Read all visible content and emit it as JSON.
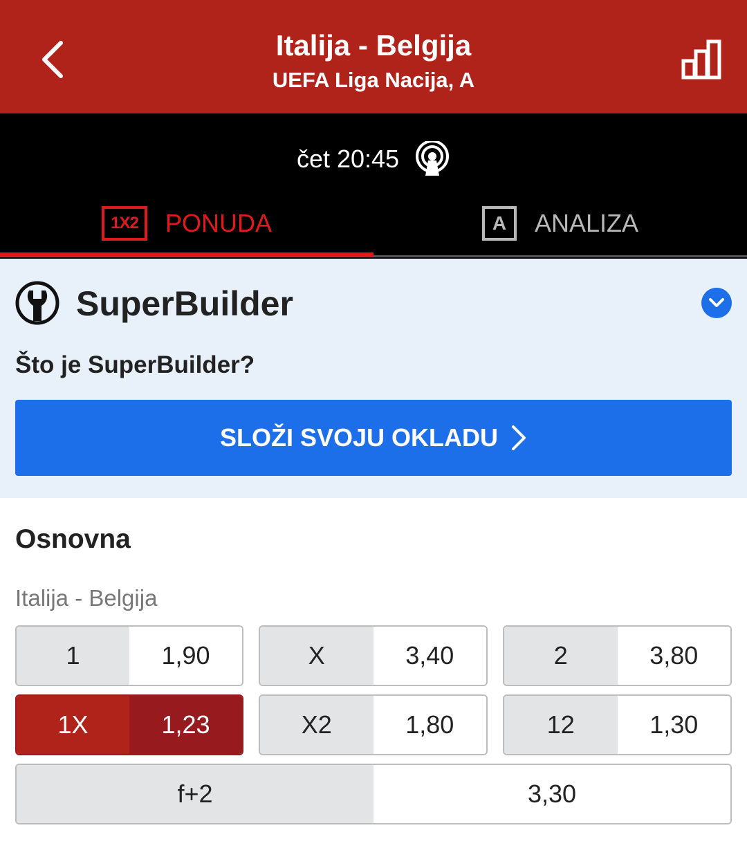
{
  "header": {
    "title": "Italija - Belgija",
    "subtitle": "UEFA Liga Nacija, A",
    "back_icon": "chevron-left-icon",
    "stats_icon": "bar-chart-icon",
    "color": "#b0231b"
  },
  "event": {
    "time": "čet 20:45",
    "live_icon": "broadcast-icon"
  },
  "tabs": [
    {
      "label": "PONUDA",
      "icon": "1X2",
      "active": true
    },
    {
      "label": "ANALIZA",
      "icon": "A",
      "active": false
    }
  ],
  "superbuilder": {
    "title": "SuperBuilder",
    "what_link": "Što je SuperBuilder?",
    "button_label": "SLOŽI SVOJU OKLADU",
    "accent": "#1c6fe8"
  },
  "markets": {
    "section_title": "Osnovna",
    "market_name": "Italija - Belgija",
    "odds": [
      {
        "label": "1",
        "value": "1,90",
        "selected": false
      },
      {
        "label": "X",
        "value": "3,40",
        "selected": false
      },
      {
        "label": "2",
        "value": "3,80",
        "selected": false
      },
      {
        "label": "1X",
        "value": "1,23",
        "selected": true
      },
      {
        "label": "X2",
        "value": "1,80",
        "selected": false
      },
      {
        "label": "12",
        "value": "1,30",
        "selected": false
      },
      {
        "label": "f+2",
        "value": "3,30",
        "selected": false
      }
    ]
  }
}
